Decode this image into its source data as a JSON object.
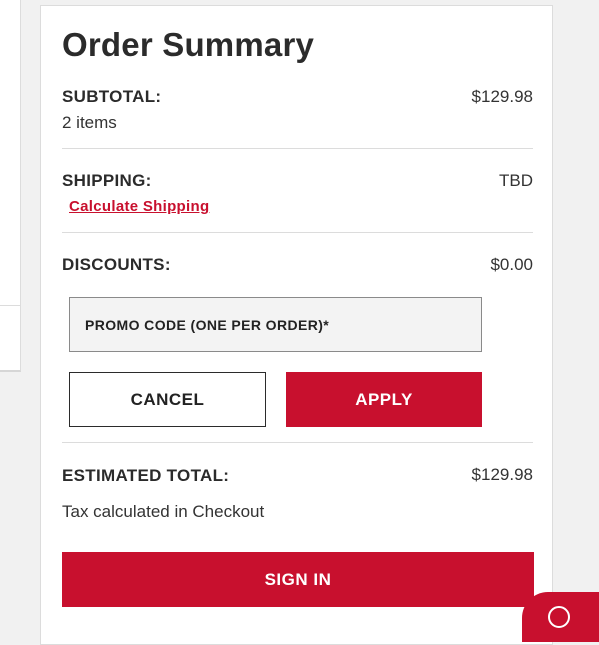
{
  "order_summary": {
    "title": "Order Summary",
    "subtotal": {
      "label": "SUBTOTAL:",
      "value": "$129.98",
      "items_count": "2 items"
    },
    "shipping": {
      "label": "SHIPPING:",
      "value": "TBD",
      "link_text": "Calculate Shipping"
    },
    "discounts": {
      "label": "DISCOUNTS:",
      "value": "$0.00"
    },
    "promo": {
      "placeholder": "PROMO CODE (ONE PER ORDER)*",
      "value": ""
    },
    "buttons": {
      "cancel_label": "CANCEL",
      "apply_label": "APPLY"
    },
    "estimated_total": {
      "label": "ESTIMATED TOTAL:",
      "value": "$129.98",
      "tax_note": "Tax calculated in Checkout"
    },
    "sign_in_label": "SIGN IN"
  },
  "colors": {
    "accent": "#c8102e",
    "text": "#2b2b2b",
    "divider": "#dcdcdc",
    "page_background": "#f1f1f1"
  },
  "icons": {
    "chat_button": "chat-icon"
  }
}
